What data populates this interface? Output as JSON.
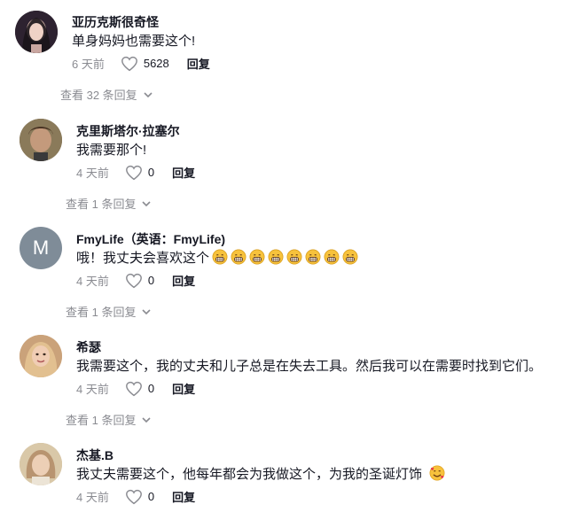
{
  "comments": [
    {
      "username": "亚历克斯很奇怪",
      "text": "单身妈妈也需要这个!",
      "time": "6 天前",
      "likes": "5628",
      "reply_label": "回复",
      "view_replies": "查看 32 条回复"
    },
    {
      "username": "克里斯塔尔·拉塞尔",
      "text": "我需要那个!",
      "time": "4 天前",
      "likes": "0",
      "reply_label": "回复",
      "view_replies": "查看 1 条回复"
    },
    {
      "username": "FmyLife（英语：FmyLife)",
      "text": "哦！我丈夫会喜欢这个",
      "avatar_letter": "M",
      "time": "4 天前",
      "likes": "0",
      "reply_label": "回复",
      "view_replies": "查看 1 条回复"
    },
    {
      "username": "希瑟",
      "text": "我需要这个，我的丈夫和儿子总是在失去工具。然后我可以在需要时找到它们。",
      "time": "4 天前",
      "likes": "0",
      "reply_label": "回复",
      "view_replies": "查看 1 条回复"
    },
    {
      "username": "杰基.B",
      "text": "我丈夫需要这个，他每年都会为我做这个，为我的圣诞灯饰",
      "time": "4 天前",
      "likes": "0",
      "reply_label": "回复"
    }
  ],
  "colors": {
    "muted": "#8a8b91",
    "primary_text": "#161823",
    "avatar_m_bg": "#7f8c98"
  }
}
